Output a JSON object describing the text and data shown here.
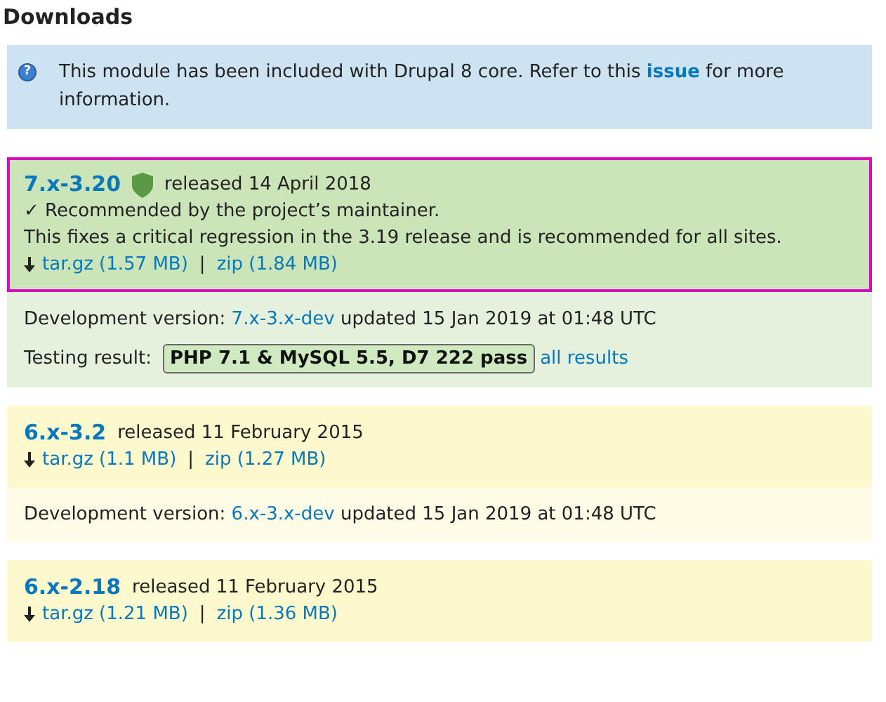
{
  "heading": "Downloads",
  "notice": {
    "icon": "?",
    "before": "This module has been included with Drupal 8 core. Refer to this",
    "link": "issue",
    "after": "for more information."
  },
  "releases": [
    {
      "kind": "recommended",
      "highlighted": true,
      "version": "7.x-3.20",
      "security": true,
      "released": "released 14 April 2018",
      "note": "✓ Recommended by the project’s maintainer.",
      "description": "This fixes a critical regression in the 3.19 release and is recommended for all sites.",
      "files": [
        "tar.gz (1.57 MB)",
        "zip (1.84 MB)"
      ],
      "separator": "|",
      "dev": {
        "label": "Development version:",
        "version": "7.x-3.x-dev",
        "updated": "updated 15 Jan 2019 at 01:48 UTC",
        "testing": {
          "label": "Testing result:",
          "result": "PHP 7.1 & MySQL 5.5, D7 222 pass",
          "link": "all results"
        }
      }
    },
    {
      "kind": "supported",
      "highlighted": false,
      "version": "6.x-3.2",
      "security": false,
      "released": "released 11 February 2015",
      "files": [
        "tar.gz (1.1 MB)",
        "zip (1.27 MB)"
      ],
      "separator": "|",
      "dev": {
        "label": "Development version:",
        "version": "6.x-3.x-dev",
        "updated": "updated 15 Jan 2019 at 01:48 UTC"
      }
    },
    {
      "kind": "supported",
      "highlighted": false,
      "version": "6.x-2.18",
      "security": false,
      "released": "released 11 February 2015",
      "files": [
        "tar.gz (1.21 MB)",
        "zip (1.36 MB)"
      ],
      "separator": "|"
    }
  ]
}
